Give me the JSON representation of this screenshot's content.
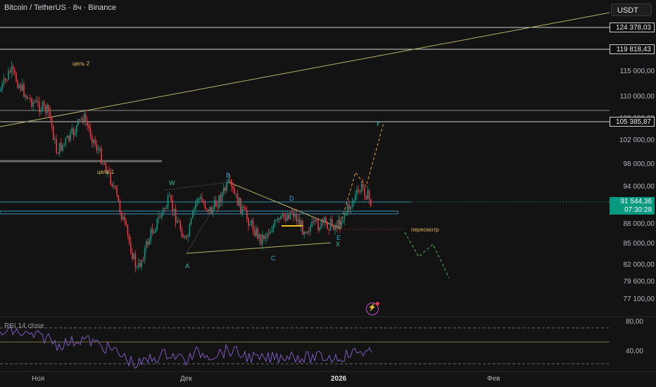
{
  "header": {
    "symbol": "Bitcoin / TetherUS · 8ч · Binance",
    "currency": "USDT"
  },
  "price_axis": {
    "ticks": [
      "115 000,00",
      "110 000,00",
      "108 000,00",
      "102 000,00",
      "98 000,00",
      "94 000,00",
      "88 000,00",
      "85 000,00",
      "82 000,00",
      "79 600,00",
      "77 100,00"
    ],
    "levels": [
      "124 378,03",
      "119 818,43",
      "105 385,87"
    ],
    "current_price": "91 544,36",
    "countdown": "07:30:28"
  },
  "time_axis": {
    "labels": [
      "Ноя",
      "Дек",
      "2026",
      "Фев"
    ]
  },
  "annotations": {
    "target2": "цель 2",
    "target1": "цель 1",
    "review": "пересмотр",
    "waves": {
      "W": "W",
      "A": "A",
      "B": "B",
      "C": "C",
      "D": "D",
      "E": "E",
      "X": "X",
      "Y": "y"
    }
  },
  "rsi": {
    "title": "RSI 14 close",
    "levels": [
      "80,00",
      "40,00"
    ]
  },
  "colors": {
    "up": "#089981",
    "down": "#f23645",
    "rsi": "#7e57c2",
    "trendline": "#b8b46a",
    "wave_label": "#2dbfa6",
    "wave_b": "#33a6d6",
    "projection": "#e0a030",
    "projection_down": "#4caf50"
  }
}
